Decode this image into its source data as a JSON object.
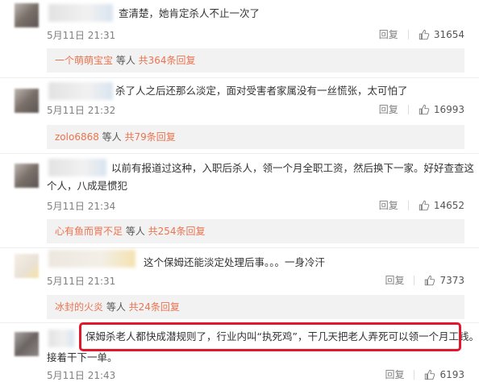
{
  "comments": [
    {
      "text": "查清楚，她肯定杀人不止一次了",
      "time": "5月11日 21:31",
      "reply_label": "回复",
      "likes": "31654",
      "replies": {
        "user": "一个萌萌宝宝",
        "mid": " 等人 ",
        "total": "共364条回复"
      }
    },
    {
      "text": "杀了人之后还那么淡定，面对受害者家属没有一丝慌张，太可怕了",
      "time": "5月11日 21:32",
      "reply_label": "回复",
      "likes": "16993",
      "replies": {
        "user": "zolo6868",
        "mid": " 等人 ",
        "total": "共79条回复"
      }
    },
    {
      "text_line1": "以前有报道过这种，入职后杀人，领一个月全职工资，然后换下一家。好好查查这",
      "text_line2": "个人，八成是惯犯",
      "time": "5月11日 21:34",
      "reply_label": "回复",
      "likes": "14652",
      "replies": {
        "user": "心有鱼而胃不足",
        "mid": " 等人 ",
        "total": "共254条回复"
      }
    },
    {
      "text": "这个保姆还能淡定处理后事。。。一身冷汗",
      "time": "5月11日 21:31",
      "reply_label": "回复",
      "likes": "7373",
      "replies": {
        "user": "冰封的火炎",
        "mid": " 等人 ",
        "total": "共24条回复"
      }
    },
    {
      "text_line1": "保姆杀老人都快成潜规则了，行业内叫“执死鸡”，干几天把老人弄死可以领一个月工钱。",
      "text_line2": "接着干下一单。",
      "time": "5月11日 21:43",
      "reply_label": "回复",
      "likes": "6193"
    }
  ],
  "colors": {
    "highlight": "#e3172b",
    "link": "#eb7350"
  },
  "icons": {
    "like": "thumbs-up-icon"
  }
}
